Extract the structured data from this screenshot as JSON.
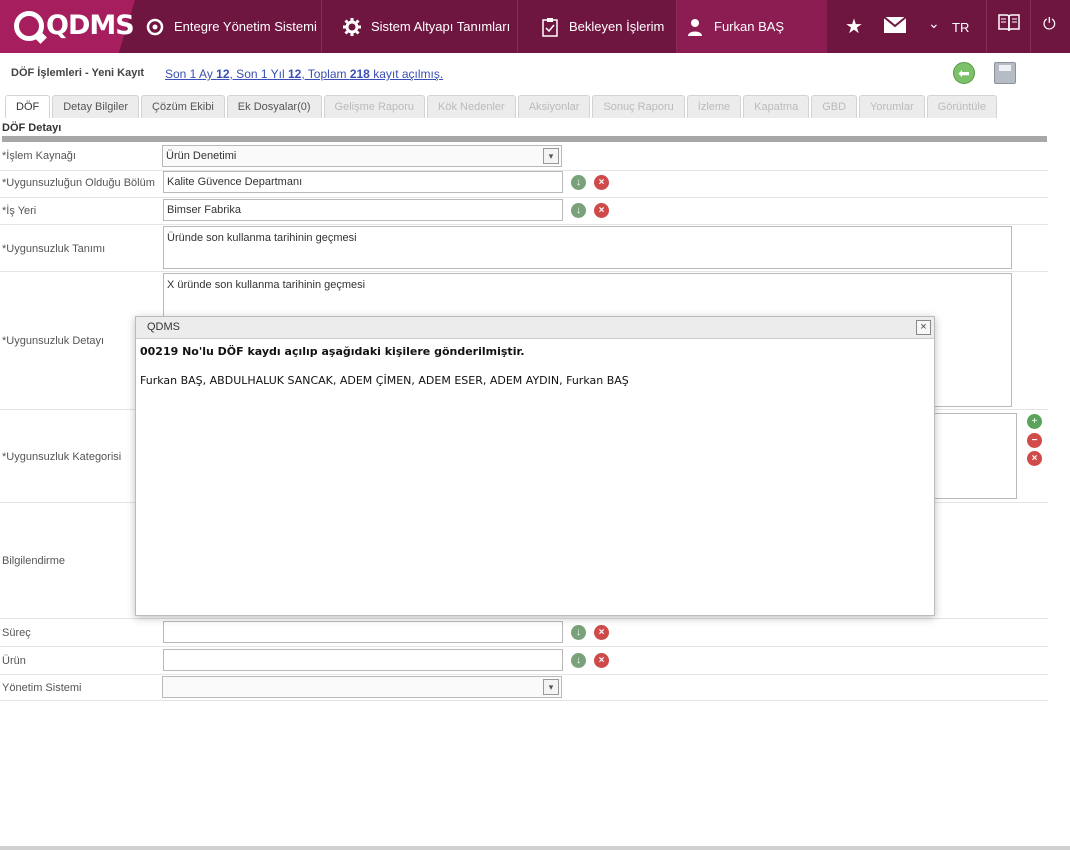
{
  "header": {
    "logo": "QDMS",
    "nav": [
      {
        "label": "Entegre Yönetim Sistemi",
        "icon": "qdms-logo-icon"
      },
      {
        "label": "Sistem Altyapı Tanımları",
        "icon": "gear-icon"
      },
      {
        "label": "Bekleyen İşlerim",
        "icon": "clipboard-icon"
      },
      {
        "label": "Furkan BAŞ",
        "icon": "user-icon"
      }
    ],
    "language": "TR"
  },
  "toolbar": {
    "breadcrumb": "DÖF İşlemleri - Yeni Kayıt",
    "link_prefix1": "Son 1 Ay ",
    "link_count1": "12",
    "link_prefix2": ", Son 1 Yıl ",
    "link_count2": "12",
    "link_prefix3": ", Toplam ",
    "link_count3": "218",
    "link_suffix": " kayıt açılmış."
  },
  "tabs": [
    {
      "label": "DÖF",
      "state": "active"
    },
    {
      "label": "Detay Bilgiler",
      "state": "enabled"
    },
    {
      "label": "Çözüm Ekibi",
      "state": "enabled"
    },
    {
      "label": "Ek Dosyalar(0)",
      "state": "enabled"
    },
    {
      "label": "Gelişme Raporu",
      "state": "disabled"
    },
    {
      "label": "Kök Nedenler",
      "state": "disabled"
    },
    {
      "label": "Aksiyonlar",
      "state": "disabled"
    },
    {
      "label": "Sonuç Raporu",
      "state": "disabled"
    },
    {
      "label": "İzleme",
      "state": "disabled"
    },
    {
      "label": "Kapatma",
      "state": "disabled"
    },
    {
      "label": "GBD",
      "state": "disabled"
    },
    {
      "label": "Yorumlar",
      "state": "disabled"
    },
    {
      "label": "Görüntüle",
      "state": "disabled"
    }
  ],
  "form": {
    "section_title": "DÖF Detayı",
    "islem_kaynagi": {
      "label": "*İşlem Kaynağı",
      "value": "Ürün Denetimi"
    },
    "bolum": {
      "label": "*Uygunsuzluğun Olduğu Bölüm",
      "value": "Kalite Güvence Departmanı"
    },
    "is_yeri": {
      "label": "*İş Yeri",
      "value": "Bimser Fabrika"
    },
    "tanim": {
      "label": "*Uygunsuzluk Tanımı",
      "value": "Üründe son kullanma tarihinin geçmesi"
    },
    "detay": {
      "label": "*Uygunsuzluk Detayı",
      "value": "X üründe son kullanma tarihinin geçmesi"
    },
    "kategori": {
      "label": "*Uygunsuzluk Kategorisi"
    },
    "bilgilendirme": {
      "label": "Bilgilendirme"
    },
    "surec": {
      "label": "Süreç",
      "value": ""
    },
    "urun": {
      "label": "Ürün",
      "value": ""
    },
    "yonetim_sistemi": {
      "label": "Yönetim Sistemi",
      "value": ""
    }
  },
  "dialog": {
    "title": "QDMS",
    "close": "×",
    "message": "00219 No'lu DÖF kaydı açılıp aşağıdaki kişilere gönderilmiştir.",
    "recipients": "Furkan BAŞ, ABDULHALUK SANCAK, ADEM ÇİMEN, ADEM ESER, ADEM AYDIN, Furkan BAŞ"
  },
  "colors": {
    "header_bg": "#6e1540",
    "logo_bg": "#a61e5e",
    "link": "#3a4fb5"
  }
}
